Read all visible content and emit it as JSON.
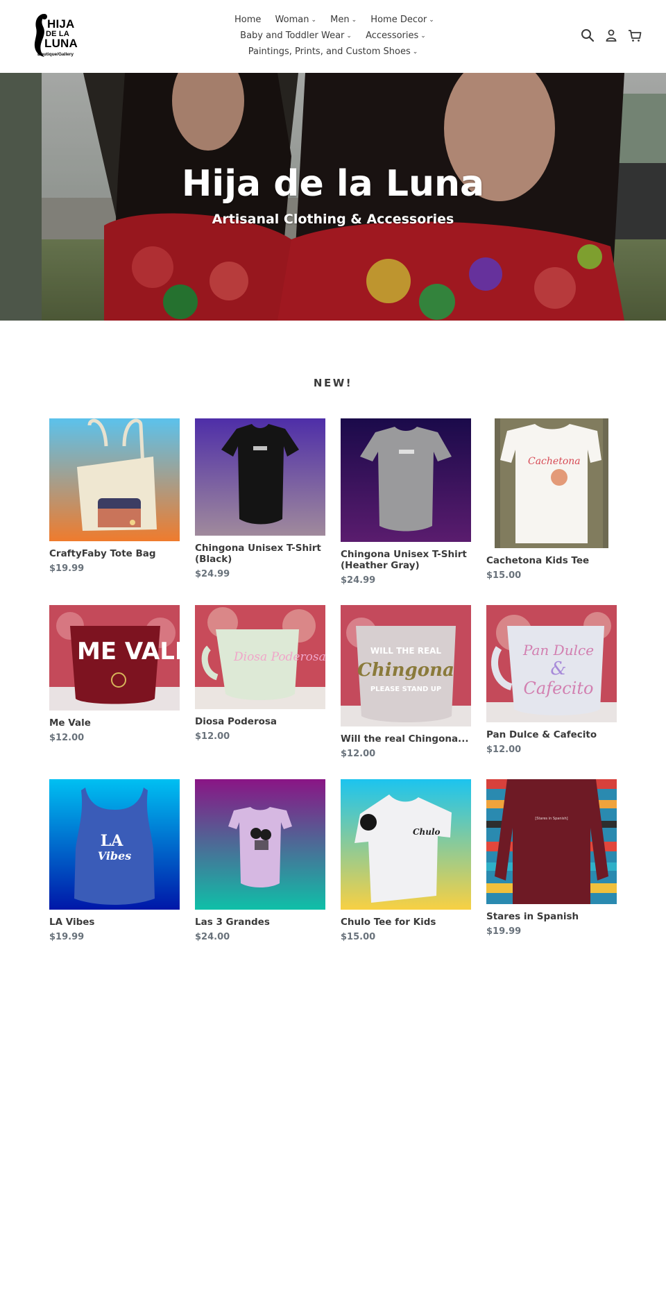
{
  "logo": {
    "line1": "HIJA",
    "line2": "DE LA",
    "line3": "LUNA",
    "subtitle": "Boutique/Gallery"
  },
  "nav": {
    "items": [
      {
        "label": "Home",
        "dropdown": false
      },
      {
        "label": "Woman",
        "dropdown": true
      },
      {
        "label": "Men",
        "dropdown": true
      },
      {
        "label": "Home Decor",
        "dropdown": true
      },
      {
        "label": "Baby and Toddler Wear",
        "dropdown": true
      },
      {
        "label": "Accessories",
        "dropdown": true
      },
      {
        "label": "Paintings, Prints, and Custom Shoes",
        "dropdown": true
      }
    ]
  },
  "header_icons": [
    "search-icon",
    "account-icon",
    "cart-icon"
  ],
  "hero": {
    "title": "Hija de la Luna",
    "subtitle": "Artisanal Clothing & Accessories"
  },
  "section": {
    "title": "NEW!"
  },
  "products": [
    {
      "name": "CraftyFaby Tote Bag",
      "price": "$19.99"
    },
    {
      "name": "Chingona Unisex T-Shirt (Black)",
      "price": "$24.99"
    },
    {
      "name": "Chingona Unisex T-Shirt (Heather Gray)",
      "price": "$24.99"
    },
    {
      "name": "Cachetona Kids Tee",
      "price": "$15.00",
      "image_text": "Cachetona"
    },
    {
      "name": "Me Vale",
      "price": "$12.00",
      "image_text": "ME VALE"
    },
    {
      "name": "Diosa Poderosa",
      "price": "$12.00",
      "image_text": "Diosa Poderosa"
    },
    {
      "name": "Will the real Chingona...",
      "price": "$12.00",
      "image_text_top": "WILL THE REAL",
      "image_text_mid": "Chingona",
      "image_text_bot": "PLEASE STAND UP"
    },
    {
      "name": "Pan Dulce & Cafecito",
      "price": "$12.00",
      "image_text_1": "Pan Dulce",
      "image_text_2": "&",
      "image_text_3": "Cafecito"
    },
    {
      "name": "LA Vibes",
      "price": "$19.99",
      "image_text_1": "LA",
      "image_text_2": "Vibes"
    },
    {
      "name": "Las 3 Grandes",
      "price": "$24.00"
    },
    {
      "name": "Chulo Tee for Kids",
      "price": "$15.00",
      "image_text": "Chulo"
    },
    {
      "name": "Stares in Spanish",
      "price": "$19.99",
      "image_text": "[Stares in Spanish]"
    }
  ],
  "colors": {
    "text": "#3a3a3a",
    "price": "#69727b",
    "accent_red": "#c62a33"
  }
}
